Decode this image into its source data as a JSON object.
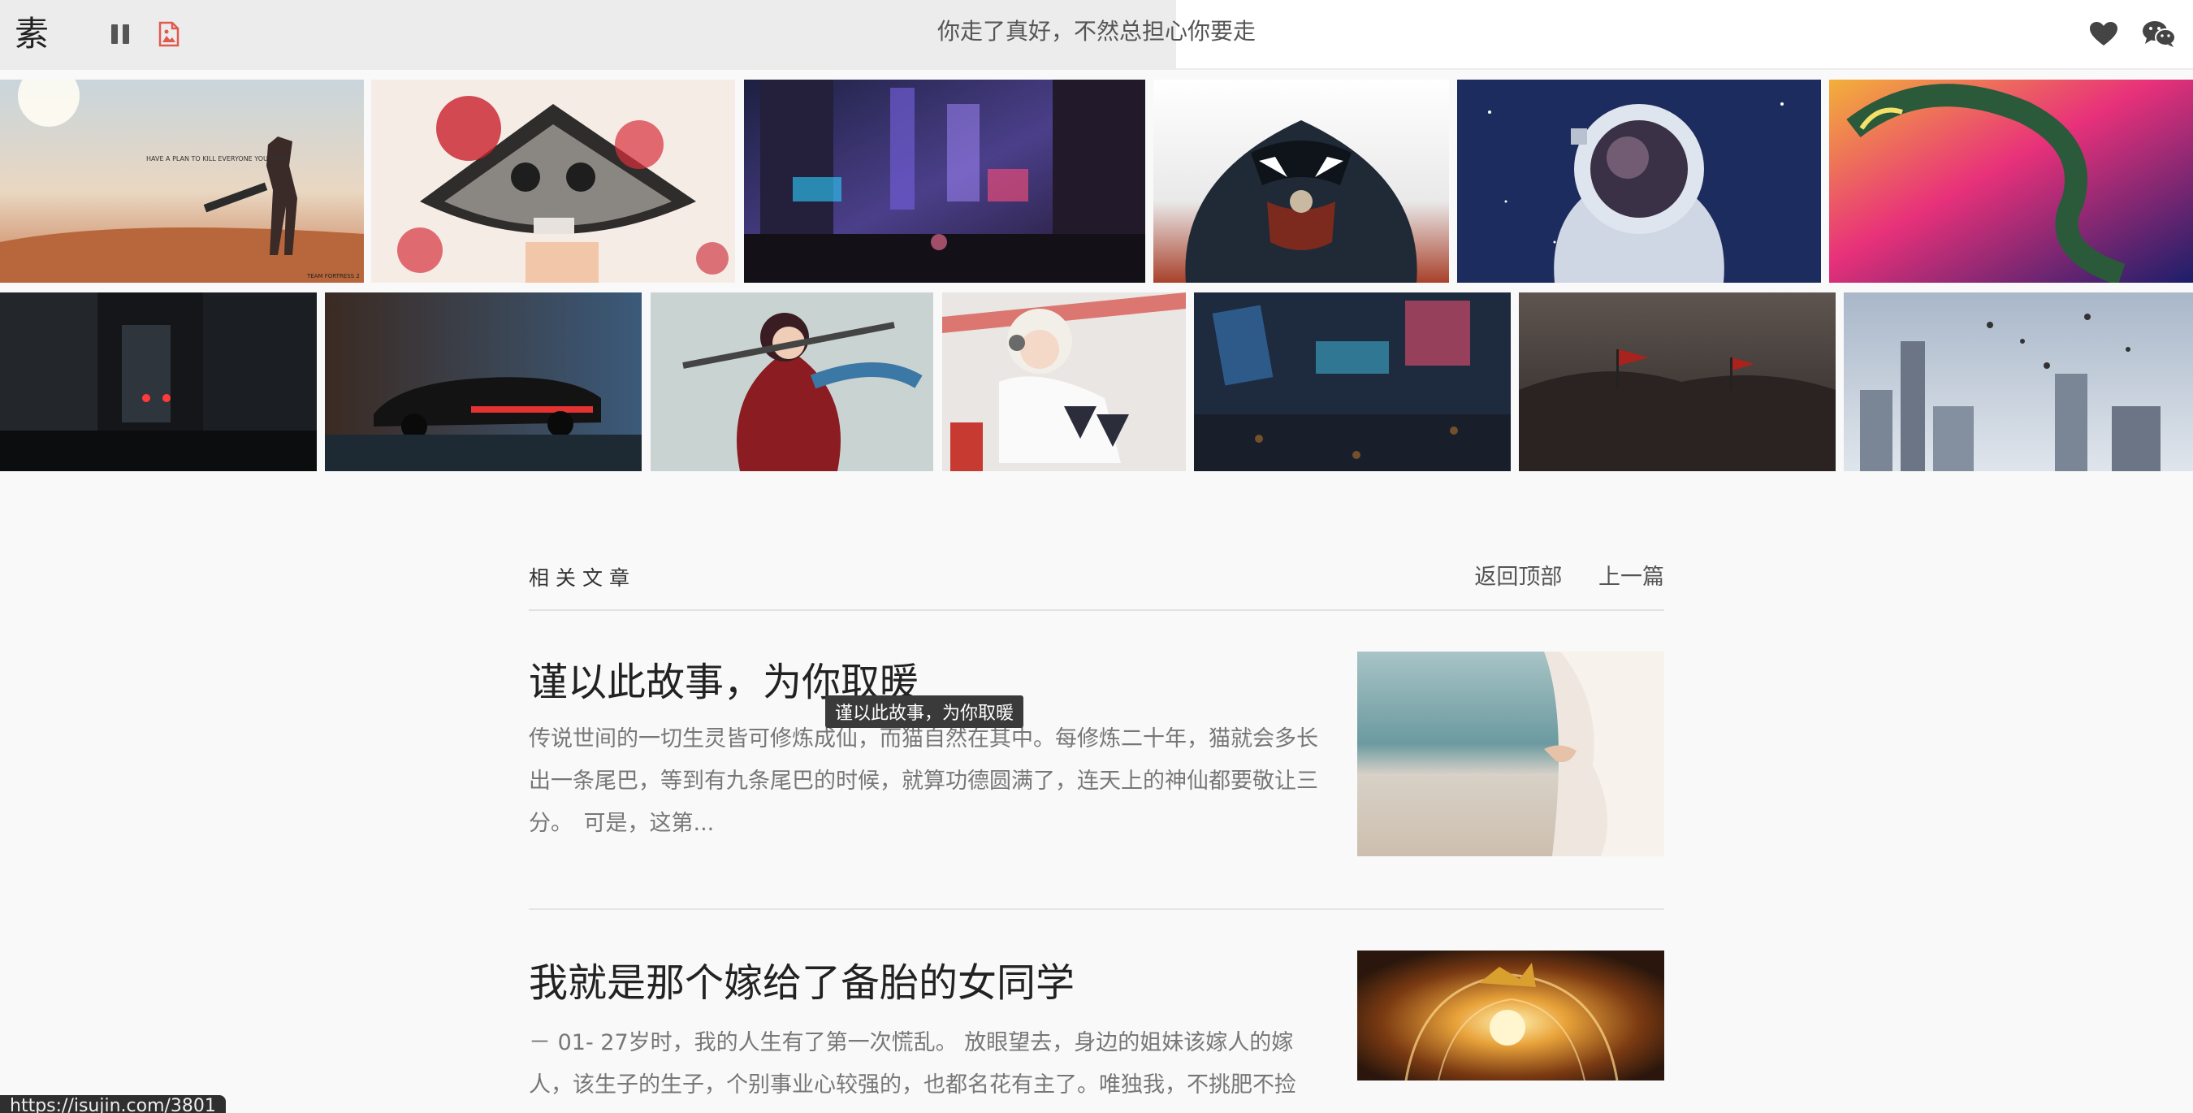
{
  "header": {
    "logo": "素",
    "title": "你走了真好，不然总担心你要走",
    "pause_icon": "pause-icon",
    "image_icon": "image-icon",
    "heart_icon": "heart-icon",
    "wechat_icon": "wechat-icon",
    "accent": "#e05a4e"
  },
  "gallery": {
    "row1": [
      {
        "name": "desert-cowboy-wallpaper",
        "caption": "HAVE A PLAN TO KILL EVERYONE YOU MEET",
        "extra": "TEAM FORTRESS 2"
      },
      {
        "name": "skull-fan-geisha-wallpaper"
      },
      {
        "name": "cyberpunk-city-street-wallpaper"
      },
      {
        "name": "venom-wallpaper"
      },
      {
        "name": "astronaut-wallpaper"
      },
      {
        "name": "neon-dragon-wallpaper"
      }
    ],
    "row2": [
      {
        "name": "dark-alley-wallpaper"
      },
      {
        "name": "cyberpunk-car-wallpaper"
      },
      {
        "name": "red-ninja-girl-wallpaper"
      },
      {
        "name": "anime-girl-headphones-wallpaper"
      },
      {
        "name": "neon-city-crowd-wallpaper"
      },
      {
        "name": "battle-army-wallpaper"
      },
      {
        "name": "flying-city-wallpaper"
      }
    ]
  },
  "related": {
    "label": "相关文章",
    "back_to_top": "返回顶部",
    "previous": "上一篇"
  },
  "articles": [
    {
      "title": "谨以此故事，为你取暖",
      "excerpt": "传说世间的一切生灵皆可修炼成仙，而猫自然在其中。每修炼二十年，猫就会多长出一条尾巴，等到有九条尾巴的时候，就算功德圆满了，连天上的神仙都要敬让三分。　可是，这第...",
      "thumb": "woman-white-dress-thumbnail"
    },
    {
      "title": "我就是那个嫁给了备胎的女同学",
      "excerpt": "－ 01- 27岁时，我的人生有了第一次慌乱。 放眼望去，身边的姐妹该嫁人的嫁人，该生子的生子，个别事业心较强的，也都名花有主了。唯独我，不挑肥不捡瘦，最后反而落了单。",
      "thumb": "glowing-orb-warrior-thumbnail"
    }
  ],
  "tooltip": "谨以此故事，为你取暖",
  "status_url": "https://isujin.com/3801"
}
